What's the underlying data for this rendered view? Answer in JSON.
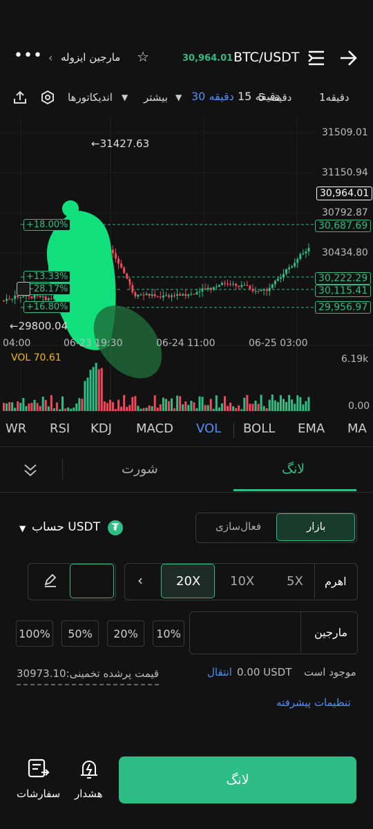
{
  "header": {
    "pair": "BTC/USDT",
    "price": "30,964.01",
    "mode": "مارجین ایزوله",
    "more": "•••"
  },
  "timeframes": {
    "items": [
      "دقیقه1",
      "دقیقه 5",
      "دقیقه 15",
      "دقیقه 30"
    ],
    "more": "بیشتر",
    "indicators": "اندیکاتورها"
  },
  "chart": {
    "price_ticks": [
      "31509.01",
      "31150.94",
      "30792.87",
      "30434.80"
    ],
    "current_price": "30,964.01",
    "level_labels": [
      "30,687.69",
      "30,222.29",
      "30,115.41",
      "29,956.97"
    ],
    "left_pct": [
      "+18.00%",
      "+13.33%",
      "+28.17%",
      "+16.80%"
    ],
    "high_label": "←31427.63",
    "low_label": "←29800.04",
    "time_labels": [
      "04:00",
      "06-23 19:30",
      "06-24 11:00",
      "06-25 03:00"
    ],
    "vol_label": "VOL 70.61",
    "vol_max": "6.19k",
    "vol_min": "0.00",
    "up_color": "#2ebd85",
    "down_color": "#f6465d"
  },
  "indicator_tabs": [
    "WR",
    "RSI",
    "KDJ",
    "MACD",
    "VOL",
    "BOLL",
    "EMA",
    "MA"
  ],
  "trade": {
    "tab_long": "لانگ",
    "tab_short": "شورت",
    "account_label": "حساب USDT",
    "order_market": "بازار",
    "order_activate": "فعال‌سازی",
    "leverage_label": "اهرم",
    "leverage_options": [
      "5X",
      "10X",
      "20X"
    ],
    "margin_label": "مارجین",
    "margin_placeholder": "",
    "pct_options": [
      "10%",
      "20%",
      "50%",
      "100%"
    ],
    "available_label": "موجود است",
    "available_value": "0.00 USDT",
    "transfer": "انتقال",
    "est_liq": "قیمت پرشده تخمینی:30973.10",
    "advanced": "تنظیمات پیشرفته",
    "submit": "لانگ",
    "nav_orders": "سفارشات",
    "nav_alert": "هشدار"
  },
  "colors": {
    "accent": "#2ebd85",
    "blue": "#4f8ff7",
    "panel": "#1b1b1b"
  }
}
